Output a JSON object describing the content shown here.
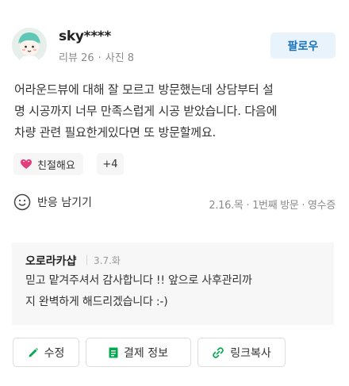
{
  "user": {
    "name": "sky****",
    "reviews_label": "리뷰 26",
    "photos_label": "사진 8"
  },
  "follow_label": "팔로우",
  "review": {
    "text": "어라운드뷰에 대해 잘 모르고 방문했는데 상담부터 설\n명 시공까지 너무 만족스럽게 시공 받았습니다. 다음에\n차량 관련 필요한게있다면 또 방문할께요."
  },
  "tags": {
    "primary": "친절해요",
    "more": "+4"
  },
  "react_label": "반응 남기기",
  "visit_meta": "2.16.목 · 1번째 방문 · 영수증",
  "owner_reply": {
    "name": "오로라카샵",
    "date": "3.7.화",
    "text": "믿고 맡겨주셔서 감사합니다 !! 앞으로 사후관리까\n지 완벽하게 해드리겠습니다 :-)"
  },
  "actions": {
    "edit": "수정",
    "payment": "결제 정보",
    "copy_link": "링크복사"
  },
  "colors": {
    "accent": "#1a73b8",
    "follow_bg": "#e8f3fc",
    "heart": "#e23d7c",
    "green_icon": "#03a94d"
  },
  "icons": {
    "avatar": "avatar-icon",
    "heart": "heart-icon",
    "smile": "smile-icon",
    "pencil": "pencil-icon",
    "receipt": "receipt-icon",
    "link": "link-icon"
  }
}
